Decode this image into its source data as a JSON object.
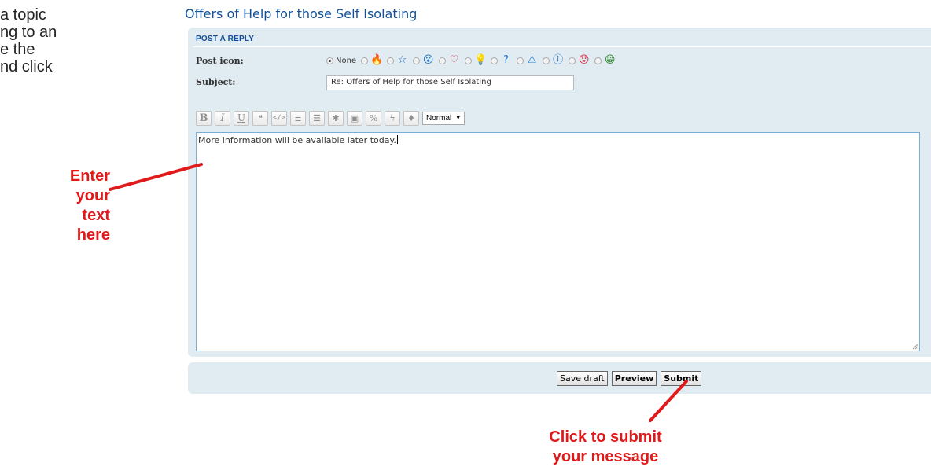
{
  "intro_text": "a topic\nng to an\ne the\nnd click",
  "page_title": "Offers of Help for those Self Isolating",
  "reply_panel": {
    "heading": "POST A REPLY",
    "post_icon_label": "Post icon:",
    "none_label": "None",
    "icons": [
      {
        "name": "fire-icon",
        "glyph": "🔥",
        "color": "#f39c12"
      },
      {
        "name": "star-icon",
        "glyph": "☆",
        "color": "#1a73c8"
      },
      {
        "name": "surprised-face-icon",
        "glyph": "😮",
        "color": "#1a73c8"
      },
      {
        "name": "heart-icon",
        "glyph": "♡",
        "color": "#d9304a"
      },
      {
        "name": "lightbulb-icon",
        "glyph": "💡",
        "color": "#f1c40f"
      },
      {
        "name": "question-icon",
        "glyph": "?",
        "color": "#1a73c8"
      },
      {
        "name": "warning-icon",
        "glyph": "⚠",
        "color": "#1a73c8"
      },
      {
        "name": "info-icon",
        "glyph": "ⓘ",
        "color": "#1a73c8"
      },
      {
        "name": "sad-face-icon",
        "glyph": "😟",
        "color": "#d9304a"
      },
      {
        "name": "grin-face-icon",
        "glyph": "😁",
        "color": "#2e8b2e"
      }
    ],
    "subject_label": "Subject:",
    "subject_value": "Re: Offers of Help for those Self Isolating",
    "font_size_value": "Normal",
    "message_text": "More information will be available later today."
  },
  "toolbar": {
    "bold": "B",
    "italic": "I",
    "underline": "U",
    "quote": "❝",
    "code": "</>",
    "list": "≣",
    "ordered_list": "☰",
    "list_item": "✱",
    "image": "▣",
    "link": "%",
    "flash": "ϟ",
    "color": "♦"
  },
  "buttons": {
    "save_draft": "Save draft",
    "preview": "Preview",
    "submit": "Submit"
  },
  "annotations": {
    "enter_text": "Enter your\ntext here",
    "click_submit": "Click to submit\nyour message"
  },
  "colors": {
    "accent": "#115098",
    "panel": "#e1ebf2",
    "annotation": "#e0191b"
  }
}
